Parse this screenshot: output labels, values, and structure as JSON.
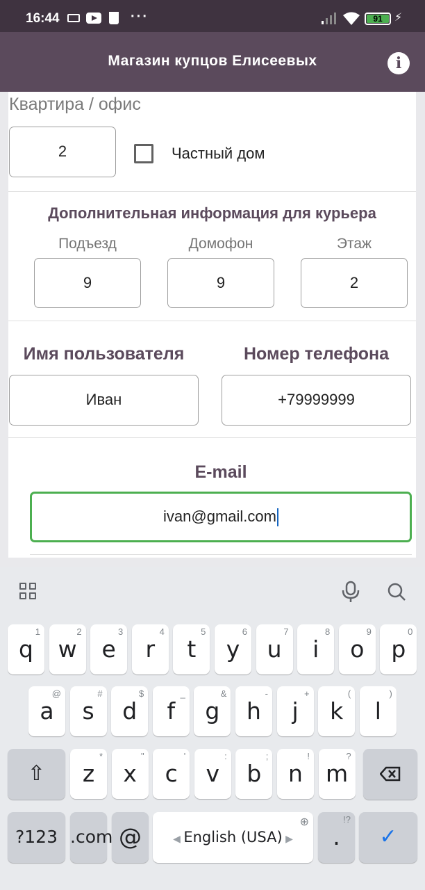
{
  "status_bar": {
    "time": "16:44",
    "battery": "91",
    "dots": "···"
  },
  "app_bar": {
    "title": "Магазин купцов Елисеевых",
    "info_glyph": "i"
  },
  "form": {
    "apartment_label": "Квартира / офис",
    "apartment_value": "2",
    "private_house_label": "Частный дом",
    "courier_section_title": "Дополнительная информация для курьера",
    "entrance_label": "Подъезд",
    "entrance_value": "9",
    "intercom_label": "Домофон",
    "intercom_value": "9",
    "floor_label": "Этаж",
    "floor_value": "2",
    "username_label": "Имя пользователя",
    "username_value": "Иван",
    "phone_label": "Номер телефона",
    "phone_value": "+79999999",
    "email_label": "E-mail",
    "email_value": "ivan@gmail.com"
  },
  "keyboard": {
    "row1": [
      {
        "key": "q",
        "hint": "1"
      },
      {
        "key": "w",
        "hint": "2"
      },
      {
        "key": "e",
        "hint": "3"
      },
      {
        "key": "r",
        "hint": "4"
      },
      {
        "key": "t",
        "hint": "5"
      },
      {
        "key": "y",
        "hint": "6"
      },
      {
        "key": "u",
        "hint": "7"
      },
      {
        "key": "i",
        "hint": "8"
      },
      {
        "key": "o",
        "hint": "9"
      },
      {
        "key": "p",
        "hint": "0"
      }
    ],
    "row2": [
      {
        "key": "a",
        "hint": "@"
      },
      {
        "key": "s",
        "hint": "#"
      },
      {
        "key": "d",
        "hint": "$"
      },
      {
        "key": "f",
        "hint": "_"
      },
      {
        "key": "g",
        "hint": "&"
      },
      {
        "key": "h",
        "hint": "-"
      },
      {
        "key": "j",
        "hint": "+"
      },
      {
        "key": "k",
        "hint": "("
      },
      {
        "key": "l",
        "hint": ")"
      }
    ],
    "row3": [
      {
        "key": "z",
        "hint": "*"
      },
      {
        "key": "x",
        "hint": "\""
      },
      {
        "key": "c",
        "hint": "'"
      },
      {
        "key": "v",
        "hint": ":"
      },
      {
        "key": "b",
        "hint": ";"
      },
      {
        "key": "n",
        "hint": "!"
      },
      {
        "key": "m",
        "hint": "?"
      }
    ],
    "symbols_label": "?123",
    "dotcom_label": ".com",
    "at_label": "@",
    "space_label": "English (USA)",
    "period_label": ".",
    "period_hint": "!?",
    "shift_glyph": "⇧",
    "enter_glyph": "✓"
  },
  "colors": {
    "status_bar": "#3f3340",
    "app_bar": "#5b4a5c",
    "section_title": "#5b4a5c",
    "email_focus_border": "#4caf50",
    "enter_check": "#1a73e8"
  }
}
